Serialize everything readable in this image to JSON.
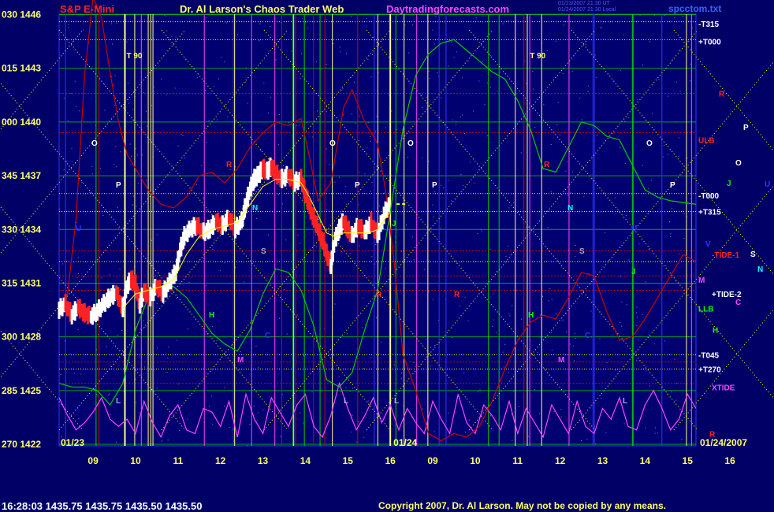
{
  "header": {
    "chart_title": "S&P E-Mini",
    "main_title": "Dr. Al Larson's Chaos Trader Web",
    "site": "Daytradingforecasts.com",
    "meta_line1": "01/23/2007 21:30 UT",
    "meta_line2": "01/24/2007 21:30 Local",
    "file_name": "spcctom.txt"
  },
  "footer": {
    "status": "16:28:03  1435.75  1435.75  1435.50  1435.50",
    "copyright": "Copyright 2007, Dr. Al Larson. May not be copied by any means."
  },
  "colors": {
    "background": "#000066",
    "price_up": "#ffffff",
    "price_down": "#ff2222",
    "ma_line": "#ffff00",
    "axis_text": "#ffff66",
    "grid_green": "#00cc00",
    "grid_yellow": "#ffff00",
    "grid_red": "#cc0000",
    "grid_blue": "#3333ff"
  },
  "chart_data": {
    "type": "line",
    "title": "S&P E-Mini",
    "y_labels": [
      {
        "deg": "030",
        "price": 1446
      },
      {
        "deg": "015",
        "price": 1443
      },
      {
        "deg": "000",
        "price": 1440
      },
      {
        "deg": "345",
        "price": 1437
      },
      {
        "deg": "330",
        "price": 1434
      },
      {
        "deg": "315",
        "price": 1431
      },
      {
        "deg": "300",
        "price": 1428
      },
      {
        "deg": "285",
        "price": 1425
      },
      {
        "deg": "270",
        "price": 1422
      }
    ],
    "ylim": [
      1422,
      1446
    ],
    "x_hours": [
      "09",
      "10",
      "11",
      "12",
      "13",
      "14",
      "15",
      "16",
      "09",
      "10",
      "11",
      "12",
      "13",
      "14",
      "15",
      "16"
    ],
    "session_dates": [
      "01/23",
      "01/24"
    ],
    "end_date": "01/24/2007",
    "right_labels": [
      {
        "text": "-T315",
        "price": 1445.5,
        "color": "#ffffff"
      },
      {
        "text": "+T000",
        "price": 1444.5,
        "color": "#ffffff"
      },
      {
        "text": "R",
        "price": 1441.6,
        "color": "#ff2222"
      },
      {
        "text": "ULB",
        "price": 1439.0,
        "color": "#ff2222"
      },
      {
        "text": "-T000",
        "price": 1435.9,
        "color": "#ffffff"
      },
      {
        "text": "+T315",
        "price": 1435.0,
        "color": "#ffffff"
      },
      {
        "text": "-TIDE-1",
        "price": 1432.6,
        "color": "#ff2222"
      },
      {
        "text": "M",
        "price": 1431.2,
        "color": "#ff44ff"
      },
      {
        "text": "+TIDE-2",
        "price": 1430.4,
        "color": "#ffffff"
      },
      {
        "text": "LLB",
        "price": 1429.6,
        "color": "#00ff00"
      },
      {
        "text": "H",
        "price": 1428.4,
        "color": "#00ff00"
      },
      {
        "text": "-T045",
        "price": 1427.0,
        "color": "#ffffff"
      },
      {
        "text": "+T270",
        "price": 1426.2,
        "color": "#ffffff"
      },
      {
        "text": "XTIDE",
        "price": 1425.2,
        "color": "#ff44ff"
      },
      {
        "text": "R",
        "price": 1422.6,
        "color": "#ff2222"
      }
    ],
    "planet_labels": [
      {
        "text": "P",
        "color": "#ffffff"
      },
      {
        "text": "O",
        "color": "#ffffff"
      },
      {
        "text": "J",
        "color": "#00ff00"
      },
      {
        "text": "U",
        "color": "#3333ff"
      },
      {
        "text": "V",
        "color": "#3333ff"
      },
      {
        "text": "S",
        "color": "#ffffff"
      },
      {
        "text": "N",
        "color": "#00ffff"
      },
      {
        "text": "C",
        "color": "#ff44ff"
      }
    ],
    "t90_labels": [
      "T 90",
      "T 90"
    ],
    "inchart_labels": {
      "O": "O",
      "P": "P",
      "S": "S",
      "N": "N",
      "R": "R",
      "H": "H",
      "M": "M",
      "C": "C",
      "J": "J",
      "U": "U",
      "V": "V",
      "L": "L"
    },
    "price_series": [
      [
        8.2,
        1429.5
      ],
      [
        8.35,
        1429.8
      ],
      [
        8.5,
        1429.2
      ],
      [
        8.65,
        1429.6
      ],
      [
        8.8,
        1429.3
      ],
      [
        8.95,
        1429.1
      ],
      [
        9.1,
        1429.4
      ],
      [
        9.25,
        1429.8
      ],
      [
        9.4,
        1430.2
      ],
      [
        9.55,
        1430.4
      ],
      [
        9.7,
        1429.6
      ],
      [
        9.8,
        1430.8
      ],
      [
        9.9,
        1431.2
      ],
      [
        10.0,
        1430.9
      ],
      [
        10.1,
        1429.8
      ],
      [
        10.2,
        1430.5
      ],
      [
        10.35,
        1430.2
      ],
      [
        10.5,
        1430.8
      ],
      [
        10.65,
        1430.4
      ],
      [
        10.8,
        1431.0
      ],
      [
        10.95,
        1431.6
      ],
      [
        11.05,
        1432.8
      ],
      [
        11.15,
        1433.6
      ],
      [
        11.3,
        1434.0
      ],
      [
        11.45,
        1434.2
      ],
      [
        11.6,
        1433.8
      ],
      [
        11.75,
        1434.0
      ],
      [
        11.9,
        1434.4
      ],
      [
        12.05,
        1434.2
      ],
      [
        12.2,
        1434.6
      ],
      [
        12.35,
        1434.0
      ],
      [
        12.5,
        1434.4
      ],
      [
        12.6,
        1435.4
      ],
      [
        12.7,
        1436.2
      ],
      [
        12.8,
        1436.8
      ],
      [
        12.9,
        1437.0
      ],
      [
        13.0,
        1437.4
      ],
      [
        13.1,
        1437.2
      ],
      [
        13.2,
        1437.5
      ],
      [
        13.3,
        1437.1
      ],
      [
        13.45,
        1436.8
      ],
      [
        13.6,
        1437.0
      ],
      [
        13.75,
        1436.6
      ],
      [
        13.9,
        1436.8
      ],
      [
        14.0,
        1436.0
      ],
      [
        14.1,
        1435.2
      ],
      [
        14.2,
        1434.6
      ],
      [
        14.3,
        1434.0
      ],
      [
        14.4,
        1433.4
      ],
      [
        14.5,
        1432.6
      ],
      [
        14.6,
        1432.0
      ],
      [
        14.7,
        1433.4
      ],
      [
        14.8,
        1434.0
      ],
      [
        14.9,
        1434.4
      ],
      [
        15.0,
        1434.0
      ],
      [
        15.1,
        1433.6
      ],
      [
        15.25,
        1434.2
      ],
      [
        15.4,
        1433.8
      ],
      [
        15.55,
        1434.4
      ],
      [
        15.7,
        1433.6
      ],
      [
        15.85,
        1434.8
      ],
      [
        16.0,
        1435.5
      ]
    ],
    "ma_series": [
      [
        9.7,
        1429.6
      ],
      [
        10.0,
        1430.4
      ],
      [
        10.3,
        1430.6
      ],
      [
        10.6,
        1430.8
      ],
      [
        10.9,
        1431.2
      ],
      [
        11.2,
        1432.6
      ],
      [
        11.5,
        1433.6
      ],
      [
        11.8,
        1434.0
      ],
      [
        12.1,
        1434.2
      ],
      [
        12.4,
        1434.4
      ],
      [
        12.7,
        1435.4
      ],
      [
        13.0,
        1436.4
      ],
      [
        13.3,
        1436.8
      ],
      [
        13.6,
        1436.8
      ],
      [
        13.9,
        1436.6
      ],
      [
        14.1,
        1435.8
      ],
      [
        14.3,
        1434.8
      ],
      [
        14.5,
        1433.8
      ],
      [
        14.7,
        1433.6
      ],
      [
        14.9,
        1433.8
      ],
      [
        15.1,
        1433.8
      ],
      [
        15.3,
        1433.8
      ],
      [
        15.5,
        1433.8
      ],
      [
        15.7,
        1434.0
      ],
      [
        16.0,
        1435.0
      ]
    ],
    "forecast_red": [
      [
        8.2,
        1429.6
      ],
      [
        8.4,
        1430.4
      ],
      [
        8.6,
        1434.6
      ],
      [
        8.8,
        1442.6
      ],
      [
        9.0,
        1447.0
      ],
      [
        9.2,
        1445.8
      ],
      [
        9.4,
        1442.8
      ],
      [
        9.6,
        1440.0
      ],
      [
        9.8,
        1438.2
      ],
      [
        10.0,
        1437.4
      ],
      [
        10.3,
        1436.2
      ],
      [
        10.6,
        1435.4
      ],
      [
        10.9,
        1435.2
      ],
      [
        11.2,
        1435.8
      ],
      [
        11.5,
        1437.0
      ],
      [
        11.8,
        1437.2
      ],
      [
        12.1,
        1436.6
      ],
      [
        12.4,
        1437.4
      ],
      [
        12.7,
        1438.6
      ],
      [
        13.0,
        1439.4
      ],
      [
        13.3,
        1440.0
      ],
      [
        13.6,
        1439.8
      ],
      [
        13.9,
        1440.2
      ],
      [
        14.1,
        1438.0
      ],
      [
        14.3,
        1435.6
      ],
      [
        14.6,
        1436.6
      ],
      [
        14.9,
        1440.8
      ],
      [
        15.1,
        1441.8
      ],
      [
        15.4,
        1440.0
      ],
      [
        15.7,
        1438.8
      ],
      [
        15.9,
        1436.0
      ],
      [
        16.1,
        1432.0
      ],
      [
        16.3,
        1427.0
      ],
      [
        16.6,
        1425.0
      ],
      [
        16.9,
        1422.6
      ],
      [
        17.2,
        1422.2
      ],
      [
        17.5,
        1422.6
      ],
      [
        17.8,
        1422.4
      ],
      [
        18.1,
        1423.0
      ],
      [
        18.4,
        1424.4
      ],
      [
        18.7,
        1426.2
      ],
      [
        19.0,
        1427.8
      ],
      [
        19.3,
        1428.8
      ],
      [
        19.6,
        1429.2
      ],
      [
        19.9,
        1429.0
      ],
      [
        20.2,
        1430.2
      ],
      [
        20.5,
        1431.6
      ],
      [
        20.8,
        1431.4
      ],
      [
        21.1,
        1429.4
      ],
      [
        21.4,
        1427.8
      ],
      [
        21.7,
        1428.0
      ],
      [
        22.0,
        1429.0
      ],
      [
        22.3,
        1430.2
      ],
      [
        22.6,
        1431.4
      ],
      [
        22.9,
        1432.6
      ],
      [
        23.2,
        1432.2
      ]
    ],
    "forecast_green": [
      [
        8.2,
        1425.4
      ],
      [
        8.5,
        1425.2
      ],
      [
        8.8,
        1425.2
      ],
      [
        9.1,
        1425.0
      ],
      [
        9.4,
        1424.2
      ],
      [
        9.7,
        1425.4
      ],
      [
        10.0,
        1428.4
      ],
      [
        10.3,
        1430.2
      ],
      [
        10.6,
        1431.0
      ],
      [
        10.9,
        1430.8
      ],
      [
        11.2,
        1430.2
      ],
      [
        11.5,
        1429.2
      ],
      [
        11.8,
        1428.2
      ],
      [
        12.1,
        1427.6
      ],
      [
        12.4,
        1427.2
      ],
      [
        12.7,
        1428.4
      ],
      [
        13.0,
        1430.4
      ],
      [
        13.3,
        1431.8
      ],
      [
        13.6,
        1431.6
      ],
      [
        13.9,
        1430.6
      ],
      [
        14.2,
        1428.6
      ],
      [
        14.5,
        1425.6
      ],
      [
        14.8,
        1425.2
      ],
      [
        15.1,
        1426.0
      ],
      [
        15.4,
        1428.4
      ],
      [
        15.7,
        1430.6
      ],
      [
        16.0,
        1435.0
      ],
      [
        16.3,
        1439.6
      ],
      [
        16.6,
        1442.6
      ],
      [
        16.9,
        1443.8
      ],
      [
        17.2,
        1444.4
      ],
      [
        17.5,
        1444.6
      ],
      [
        17.8,
        1444.0
      ],
      [
        18.1,
        1443.4
      ],
      [
        18.4,
        1442.8
      ],
      [
        18.7,
        1442.4
      ],
      [
        19.0,
        1441.2
      ],
      [
        19.3,
        1439.6
      ],
      [
        19.6,
        1437.4
      ],
      [
        19.9,
        1437.2
      ],
      [
        20.2,
        1438.6
      ],
      [
        20.5,
        1440.0
      ],
      [
        20.8,
        1439.8
      ],
      [
        21.1,
        1439.2
      ],
      [
        21.4,
        1439.0
      ],
      [
        21.7,
        1437.6
      ],
      [
        22.0,
        1436.2
      ],
      [
        22.3,
        1435.8
      ],
      [
        22.6,
        1435.6
      ],
      [
        23.2,
        1435.4
      ]
    ],
    "forecast_magenta_seed": [
      [
        8.2,
        1424.6
      ],
      [
        8.4,
        1423.6
      ],
      [
        8.6,
        1422.8
      ],
      [
        8.8,
        1423.2
      ],
      [
        9.0,
        1423.8
      ],
      [
        9.2,
        1424.6
      ],
      [
        9.4,
        1423.4
      ],
      [
        9.6,
        1423.0
      ],
      [
        9.8,
        1423.4
      ],
      [
        10.0,
        1422.6
      ],
      [
        10.2,
        1424.4
      ],
      [
        10.4,
        1423.2
      ],
      [
        10.6,
        1422.4
      ],
      [
        10.8,
        1423.6
      ],
      [
        11.0,
        1424.2
      ],
      [
        11.2,
        1422.8
      ],
      [
        11.4,
        1422.6
      ],
      [
        11.6,
        1424.0
      ],
      [
        11.8,
        1423.8
      ],
      [
        12.0,
        1423.0
      ],
      [
        12.2,
        1424.4
      ],
      [
        12.4,
        1422.4
      ],
      [
        12.6,
        1424.8
      ],
      [
        12.8,
        1423.4
      ],
      [
        13.0,
        1422.6
      ],
      [
        13.2,
        1424.6
      ],
      [
        13.4,
        1423.8
      ],
      [
        13.6,
        1423.0
      ],
      [
        13.8,
        1424.2
      ],
      [
        14.0,
        1424.8
      ],
      [
        14.2,
        1423.0
      ],
      [
        14.4,
        1422.4
      ],
      [
        14.6,
        1423.6
      ],
      [
        14.8,
        1425.4
      ],
      [
        15.0,
        1424.0
      ],
      [
        15.2,
        1422.8
      ],
      [
        15.4,
        1423.6
      ],
      [
        15.6,
        1424.6
      ],
      [
        15.8,
        1423.2
      ],
      [
        16.0,
        1424.2
      ],
      [
        16.2,
        1422.8
      ],
      [
        16.4,
        1424.0
      ],
      [
        16.6,
        1423.2
      ],
      [
        16.8,
        1422.6
      ],
      [
        17.0,
        1424.4
      ],
      [
        17.2,
        1423.4
      ],
      [
        17.4,
        1422.6
      ],
      [
        17.6,
        1424.8
      ],
      [
        17.8,
        1423.2
      ],
      [
        18.0,
        1422.6
      ],
      [
        18.2,
        1424.2
      ],
      [
        18.4,
        1423.6
      ],
      [
        18.6,
        1422.8
      ],
      [
        18.8,
        1424.4
      ],
      [
        19.0,
        1422.6
      ],
      [
        19.2,
        1424.0
      ],
      [
        19.4,
        1423.2
      ],
      [
        19.6,
        1422.4
      ],
      [
        19.8,
        1424.2
      ],
      [
        20.0,
        1423.4
      ],
      [
        20.2,
        1422.6
      ],
      [
        20.4,
        1424.4
      ],
      [
        20.6,
        1423.0
      ],
      [
        20.8,
        1422.6
      ],
      [
        21.0,
        1424.0
      ],
      [
        21.2,
        1423.4
      ],
      [
        21.4,
        1424.6
      ],
      [
        21.6,
        1423.0
      ],
      [
        21.8,
        1422.8
      ],
      [
        22.0,
        1424.2
      ],
      [
        22.2,
        1425.0
      ],
      [
        22.4,
        1424.0
      ],
      [
        22.6,
        1422.8
      ],
      [
        22.8,
        1423.4
      ],
      [
        23.0,
        1424.8
      ],
      [
        23.2,
        1424.0
      ]
    ]
  }
}
